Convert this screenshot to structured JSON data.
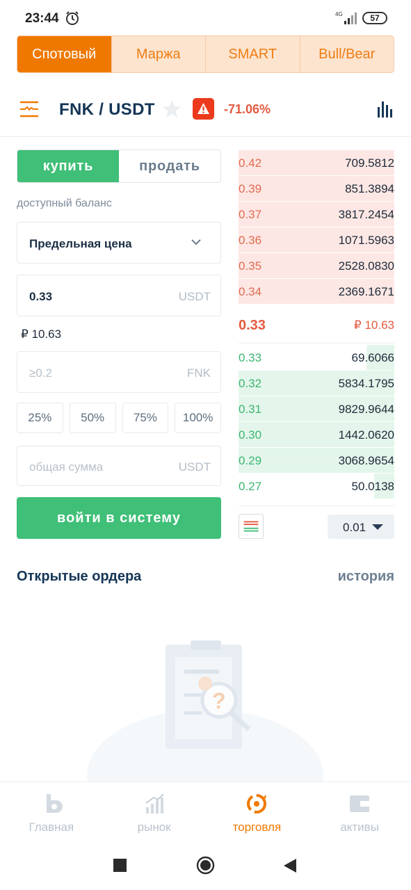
{
  "status_bar": {
    "time": "23:44",
    "network": "4G",
    "battery": "57"
  },
  "mode_tabs": [
    {
      "label": "Спотовый",
      "active": true
    },
    {
      "label": "Маржа",
      "active": false
    },
    {
      "label": "SMART",
      "active": false
    },
    {
      "label": "Bull/Bear",
      "active": false
    }
  ],
  "pair": {
    "symbol": "FNK / USDT",
    "change": "-71.06%"
  },
  "trade_form": {
    "buy_label": "купить",
    "sell_label": "продать",
    "balance_label": "доступный баланс",
    "order_type": "Предельная цена",
    "price_value": "0.33",
    "price_unit": "USDT",
    "price_rub": "₽ 10.63",
    "amount_placeholder": "≥0.2",
    "amount_unit": "FNK",
    "percent_options": [
      "25%",
      "50%",
      "75%",
      "100%"
    ],
    "total_placeholder": "общая сумма",
    "total_unit": "USDT",
    "login_label": "войти в систему"
  },
  "order_book": {
    "asks": [
      {
        "price": "0.42",
        "qty": "709.5812",
        "depth": 1.0
      },
      {
        "price": "0.39",
        "qty": "851.3894",
        "depth": 1.0
      },
      {
        "price": "0.37",
        "qty": "3817.2454",
        "depth": 1.0
      },
      {
        "price": "0.36",
        "qty": "1071.5963",
        "depth": 1.0
      },
      {
        "price": "0.35",
        "qty": "2528.0830",
        "depth": 1.0
      },
      {
        "price": "0.34",
        "qty": "2369.1671",
        "depth": 1.0
      }
    ],
    "last_price": "0.33",
    "last_price_rub": "₽ 10.63",
    "bids": [
      {
        "price": "0.33",
        "qty": "69.6066",
        "depth": 0.18
      },
      {
        "price": "0.32",
        "qty": "5834.1795",
        "depth": 1.0
      },
      {
        "price": "0.31",
        "qty": "9829.9644",
        "depth": 1.0
      },
      {
        "price": "0.30",
        "qty": "1442.0620",
        "depth": 1.0
      },
      {
        "price": "0.29",
        "qty": "3068.9654",
        "depth": 1.0
      },
      {
        "price": "0.27",
        "qty": "50.0138",
        "depth": 0.13
      }
    ],
    "depth_step": "0.01"
  },
  "orders": {
    "title": "Открытые ордера",
    "history_label": "история"
  },
  "bottom_nav": [
    {
      "label": "Главная",
      "icon": "home-icon",
      "active": false
    },
    {
      "label": "рынок",
      "icon": "market-icon",
      "active": false
    },
    {
      "label": "торговля",
      "icon": "trade-icon",
      "active": true
    },
    {
      "label": "активы",
      "icon": "wallet-icon",
      "active": false
    }
  ],
  "colors": {
    "accent": "#ef7800",
    "buy": "#3fbf77",
    "sell": "#e35a3f"
  }
}
